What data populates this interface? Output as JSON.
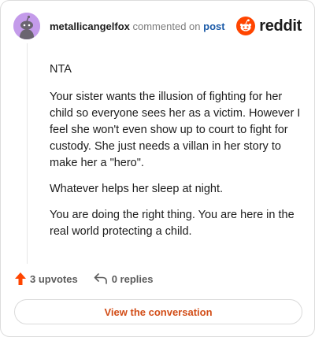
{
  "comment": {
    "username": "metallicangelfox",
    "meta_text": "commented on",
    "post_link": "post",
    "avatar_icon": "snoo-avatar-icon",
    "avatar_bg": "#c49bea",
    "paragraphs": [
      "NTA",
      "Your sister wants the illusion of fighting for her child so everyone sees her as a victim. However I feel she won't even show up to court to fight for custody. She just needs a villan in her story to make her a \"hero\".",
      "Whatever helps her sleep at night.",
      "You are doing the right thing. You are here in the real world protecting a child."
    ]
  },
  "brand": {
    "wordmark": "reddit",
    "icon": "reddit-logo-icon",
    "accent_color": "#ff4500"
  },
  "actions": {
    "upvotes_label": "3 upvotes",
    "upvote_icon": "upvote-arrow-icon",
    "upvote_color": "#ff4500",
    "replies_label": "0 replies",
    "reply_icon": "reply-arrow-icon"
  },
  "cta": {
    "label": "View the conversation",
    "color": "#d24d17"
  }
}
